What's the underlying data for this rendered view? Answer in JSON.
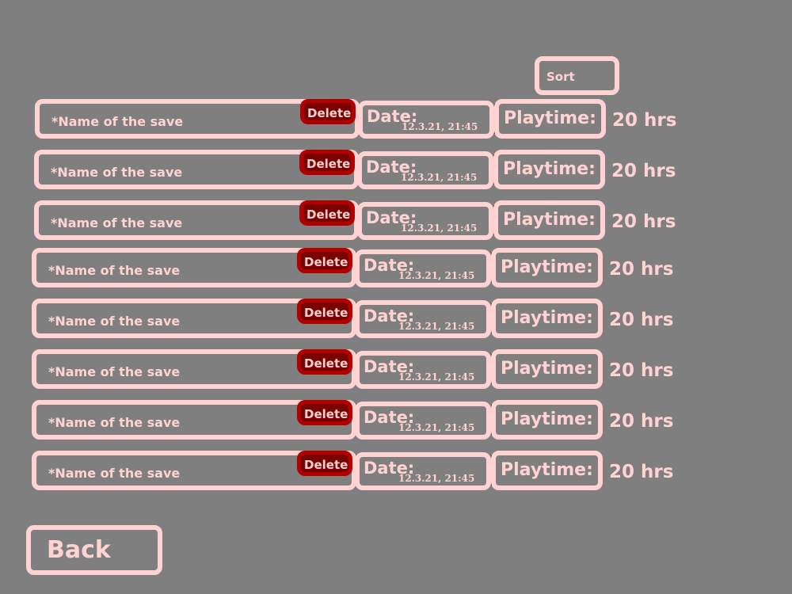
{
  "header": {
    "sort_label": "Sort"
  },
  "saves": [
    {
      "name": "*Name of the save",
      "delete_label": "Delete",
      "date_label": "Date:",
      "date_value": "12.3.21, 21:45",
      "playtime_label": "Playtime:",
      "playtime_value": "20 hrs"
    },
    {
      "name": "*Name of the save",
      "delete_label": "Delete",
      "date_label": "Date:",
      "date_value": "12.3.21, 21:45",
      "playtime_label": "Playtime:",
      "playtime_value": "20 hrs"
    },
    {
      "name": "*Name of the save",
      "delete_label": "Delete",
      "date_label": "Date:",
      "date_value": "12.3.21, 21:45",
      "playtime_label": "Playtime:",
      "playtime_value": "20 hrs"
    },
    {
      "name": "*Name of the save",
      "delete_label": "Delete",
      "date_label": "Date:",
      "date_value": "12.3.21, 21:45",
      "playtime_label": "Playtime:",
      "playtime_value": "20 hrs"
    },
    {
      "name": "*Name of the save",
      "delete_label": "Delete",
      "date_label": "Date:",
      "date_value": "12.3.21, 21:45",
      "playtime_label": "Playtime:",
      "playtime_value": "20 hrs"
    },
    {
      "name": "*Name of the save",
      "delete_label": "Delete",
      "date_label": "Date:",
      "date_value": "12.3.21, 21:45",
      "playtime_label": "Playtime:",
      "playtime_value": "20 hrs"
    },
    {
      "name": "*Name of the save",
      "delete_label": "Delete",
      "date_label": "Date:",
      "date_value": "12.3.21, 21:45",
      "playtime_label": "Playtime:",
      "playtime_value": "20 hrs"
    },
    {
      "name": "*Name of the save",
      "delete_label": "Delete",
      "date_label": "Date:",
      "date_value": "12.3.21, 21:45",
      "playtime_label": "Playtime:",
      "playtime_value": "20 hrs"
    }
  ],
  "footer": {
    "back_label": "Back"
  },
  "colors": {
    "background": "#7f7f7f",
    "text": "#ffd3d2",
    "delete_fill": "#7a0000",
    "delete_border": "#b20000"
  }
}
